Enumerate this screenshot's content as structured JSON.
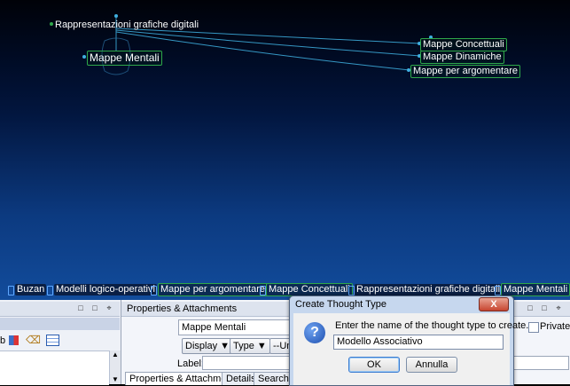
{
  "brain": {
    "parent_thought": "Rappresentazioni grafiche digitali",
    "active_thought": "Mappe Mentali",
    "children": [
      "Mappe Concettuali",
      "Mappe Dinamiche",
      "Mappe per argomentare"
    ]
  },
  "pinned": [
    "Buzan",
    "Modelli logico-operativi",
    "Mappe per argomentare",
    "Mappe Concettuali",
    "Rappresentazioni grafiche digitali",
    "Mappe Mentali"
  ],
  "panels": {
    "left_controls": [
      "□",
      "□",
      "⌖"
    ],
    "properties_title": "Properties & Attachments",
    "properties_controls": [
      "□",
      "□",
      "⌖"
    ],
    "thought_name": "Mappe Mentali",
    "display_label": "Display",
    "type_label": "Type",
    "third_label": "--Unl",
    "private_label": "Private",
    "label_caption": "Label:",
    "tabs": [
      "Properties & Attachments",
      "Details",
      "Search"
    ]
  },
  "dialog": {
    "title": "Create Thought Type",
    "close_glyph": "X",
    "icon": "?",
    "message": "Enter the name of the thought type to create.",
    "input_value": "Modello Associativo",
    "ok_label": "OK",
    "cancel_label": "Annulla"
  },
  "colors": {
    "thought_border": "#2fa84a",
    "link_line": "#3fb0e0",
    "brain_bg_top": "#000208",
    "brain_bg_bottom": "#124c9c"
  }
}
